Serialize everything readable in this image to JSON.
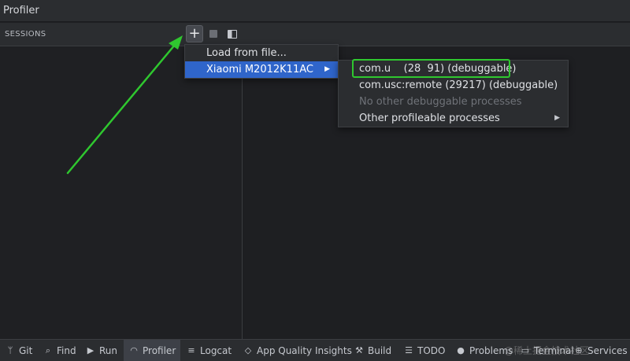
{
  "window": {
    "title": "Profiler"
  },
  "sessions": {
    "label": "SESSIONS",
    "add_icon_glyph": "+"
  },
  "menu_device": {
    "load_label": "Load from file...",
    "device_label": "Xiaomi M2012K11AC",
    "submenu_arrow": "▶"
  },
  "menu_processes": {
    "items": [
      "com.u    (28  91) (debuggable)",
      "com.usc:remote (29217) (debuggable)",
      "No other debuggable processes",
      "Other profileable processes"
    ],
    "submenu_arrow": "▶"
  },
  "bottom_bar": {
    "items": [
      {
        "label": "Git",
        "icon": "git-branch-icon",
        "glyph": "ᛘ"
      },
      {
        "label": "Find",
        "icon": "search-icon",
        "glyph": "⌕"
      },
      {
        "label": "Run",
        "icon": "run-icon",
        "glyph": "▶"
      },
      {
        "label": "Profiler",
        "icon": "profiler-gauge-icon",
        "glyph": "◠"
      },
      {
        "label": "Logcat",
        "icon": "logcat-icon",
        "glyph": "≡"
      },
      {
        "label": "App Quality Insights",
        "icon": "diamond-icon",
        "glyph": "◇"
      },
      {
        "label": "Build",
        "icon": "hammer-icon",
        "glyph": "⚒"
      },
      {
        "label": "TODO",
        "icon": "list-icon",
        "glyph": "☰"
      },
      {
        "label": "Problems",
        "icon": "problems-icon",
        "glyph": "●"
      },
      {
        "label": "Terminal",
        "icon": "terminal-icon",
        "glyph": "▭"
      },
      {
        "label": "Services",
        "icon": "services-icon",
        "glyph": "⊕"
      }
    ],
    "watermark": "@稀土掘金技术社区"
  },
  "colors": {
    "accent_selection": "#2f65ca",
    "annotation_green": "#2fc72f"
  }
}
